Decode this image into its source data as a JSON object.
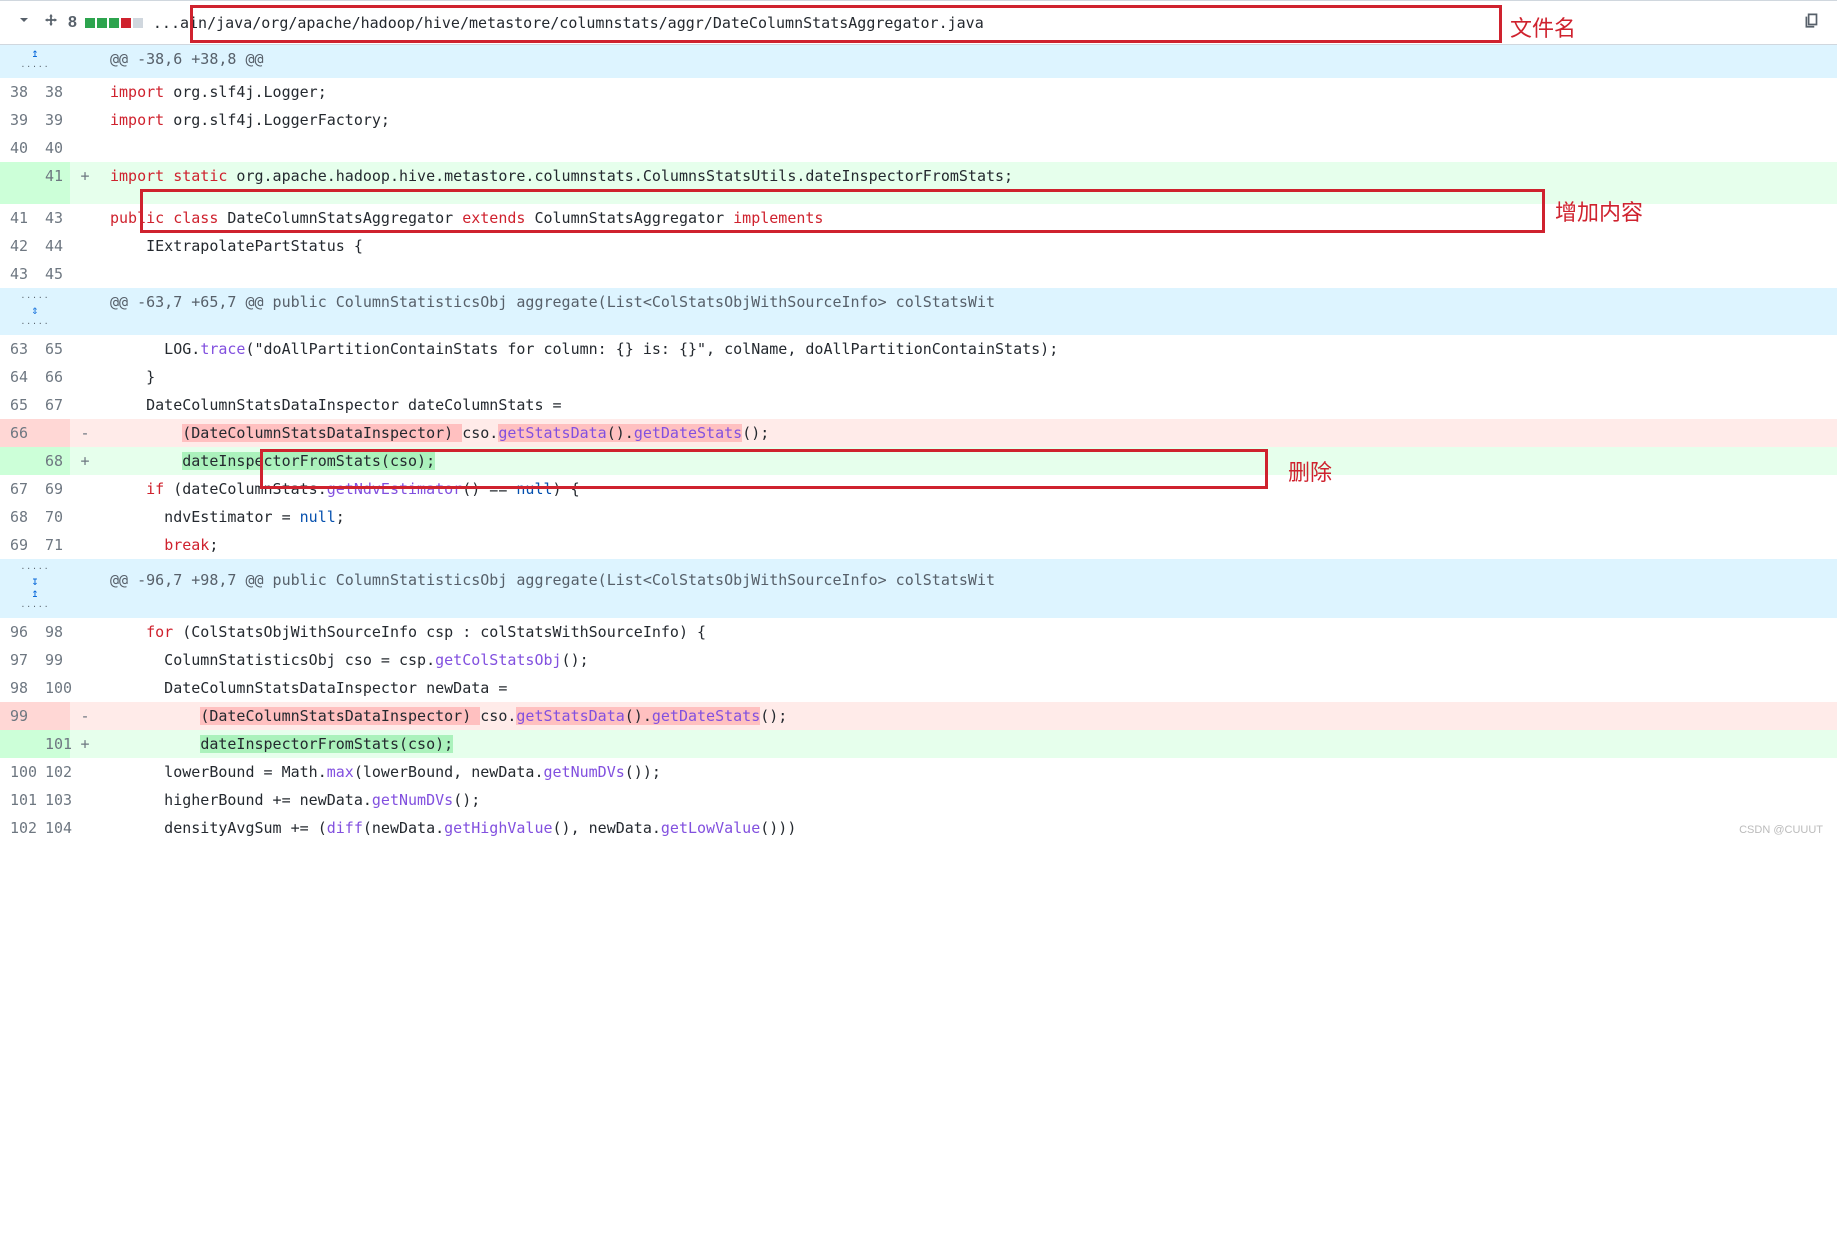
{
  "header": {
    "fileNumber": "8",
    "filePath": "...ain/java/org/apache/hadoop/hive/metastore/columnstats/aggr/DateColumnStatsAggregator.java"
  },
  "annotations": {
    "filename": "文件名",
    "added": "增加内容",
    "deleted": "删除"
  },
  "hunks": [
    "@@ -38,6 +38,8 @@",
    "@@ -63,7 +65,7 @@ public ColumnStatisticsObj aggregate(List<ColStatsObjWithSourceInfo> colStatsWit",
    "@@ -96,7 +98,7 @@ public ColumnStatisticsObj aggregate(List<ColStatsObjWithSourceInfo> colStatsWit"
  ],
  "lines": {
    "l38": {
      "old": "38",
      "new": "38"
    },
    "l39": {
      "old": "39",
      "new": "39"
    },
    "l40": {
      "old": "40",
      "new": "40"
    },
    "l41a": {
      "old": "",
      "new": "41"
    },
    "l41": {
      "old": "41",
      "new": "43"
    },
    "l42": {
      "old": "42",
      "new": "44"
    },
    "l43": {
      "old": "43",
      "new": "45"
    },
    "l63": {
      "old": "63",
      "new": "65"
    },
    "l64": {
      "old": "64",
      "new": "66"
    },
    "l65": {
      "old": "65",
      "new": "67"
    },
    "l66d": {
      "old": "66",
      "new": ""
    },
    "l68a": {
      "old": "",
      "new": "68"
    },
    "l67": {
      "old": "67",
      "new": "69"
    },
    "l68": {
      "old": "68",
      "new": "70"
    },
    "l69": {
      "old": "69",
      "new": "71"
    },
    "l96": {
      "old": "96",
      "new": "98"
    },
    "l97": {
      "old": "97",
      "new": "99"
    },
    "l98": {
      "old": "98",
      "new": "100"
    },
    "l99d": {
      "old": "99",
      "new": ""
    },
    "l101a": {
      "old": "",
      "new": "101"
    },
    "l100": {
      "old": "100",
      "new": "102"
    },
    "l101": {
      "old": "101",
      "new": "103"
    },
    "l102": {
      "old": "102",
      "new": "104"
    }
  },
  "tokens": {
    "import": "import",
    "static": "static",
    "public": "public",
    "class": "class",
    "extends": "extends",
    "implements": "implements",
    "if": "if",
    "null": "null",
    "break": "break",
    "for": "for",
    "pkg_logger": " org.slf4j.Logger;",
    "pkg_loggerFactory": " org.slf4j.LoggerFactory;",
    "pkg_static": " org.apache.hadoop.hive.metastore.columnstats.ColumnsStatsUtils.dateInspectorFromStats;",
    "cls_name": " DateColumnStatsAggregator ",
    "cls_super": " ColumnStatsAggregator ",
    "iface_line": "    IExtrapolatePartStatus {",
    "log_prefix": "      LOG.",
    "trace": "trace",
    "log_args": "(\"doAllPartitionContainStats for column: {} is: {}\", colName, doAllPartitionContainStats);",
    "brace_close4": "    }",
    "dcs_decl": "    DateColumnStatsDataInspector dateColumnStats =",
    "cast_del": "(DateColumnStatsDataInspector) ",
    "cso_get": "cso.",
    "getStatsData": "getStatsData",
    "getDateStats": "getDateStats",
    "paren_dot": "().",
    "paren_semi": "();",
    "add_line1": "dateInspectorFromStats(cso);",
    "if_open": " (dateColumnStats.",
    "getNdvEstimator": "getNdvEstimator",
    "if_tail": "() == ",
    "if_end": ") {",
    "ndv_line": "      ndvEstimator = ",
    "semi": ";",
    "for_open": " (ColStatsObjWithSourceInfo csp : colStatsWithSourceInfo) {",
    "cso_line_a": "      ColumnStatisticsObj cso = csp.",
    "getColStatsObj": "getColStatsObj",
    "newdata_decl": "      DateColumnStatsDataInspector newData =",
    "lower_line_a": "      lowerBound = Math.",
    "max": "max",
    "lower_line_b": "(lowerBound, newData.",
    "getNumDVs": "getNumDVs",
    "paren2_semi": "());",
    "higher_line": "      higherBound += newData.",
    "density_a": "      densityAvgSum += (",
    "diff": "diff",
    "density_b": "(newData.",
    "getHighValue": "getHighValue",
    "density_c": "(), newData.",
    "getLowValue": "getLowValue",
    "density_d": "()))",
    "indent8": "        ",
    "indent10": "          ",
    "indent6": "      "
  },
  "watermark": "CSDN @CUUUT"
}
